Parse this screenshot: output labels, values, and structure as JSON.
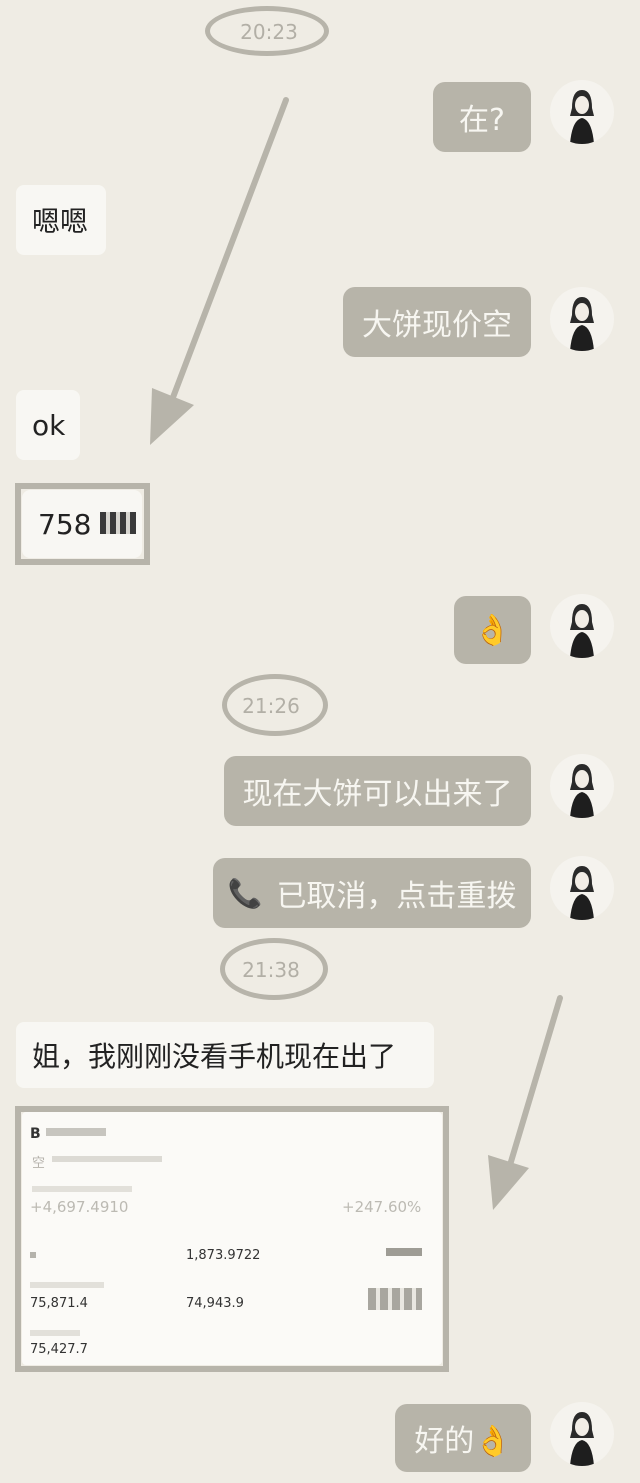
{
  "times": [
    "20:23",
    "21:26",
    "21:38"
  ],
  "messages": {
    "m1": "在?",
    "m2": "嗯嗯",
    "m3": "大饼现价空",
    "m4": "ok",
    "m5": "758",
    "m6": "👌",
    "m7": "现在大饼可以出来了",
    "m8": "已取消，点击重拨",
    "m9": "姐，我刚刚没看手机现在出了",
    "m10": "好的👌"
  },
  "card": {
    "title": "B",
    "subtitle": "空",
    "pnl": "+4,697.4910",
    "roe": "+247.60%",
    "v1": "1,873.9722",
    "v2": "75,871.4",
    "v3": "74,943.9",
    "v4": "75,427.7"
  },
  "icons": {
    "call": "phone-icon",
    "ok": "ok-hand-icon",
    "avatar": "user-avatar"
  },
  "colors": {
    "background": "#efece4",
    "sent_bubble": "#b7b4a9",
    "received_bubble": "#f8f7f3",
    "annotation": "#b7b4aa"
  }
}
